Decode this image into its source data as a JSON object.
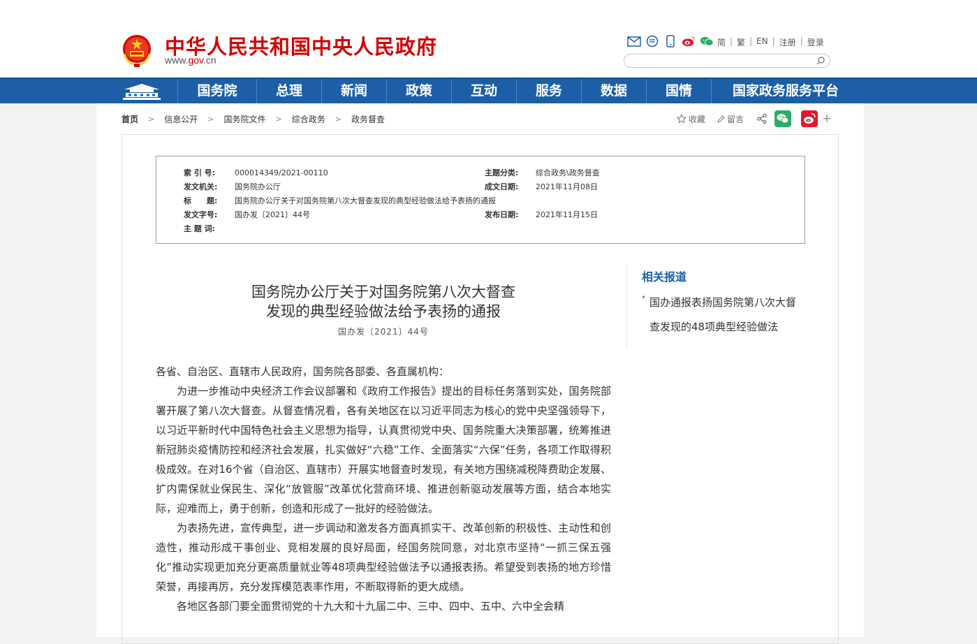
{
  "header": {
    "site_title": "中华人民共和国中央人民政府",
    "site_url_prefix": "www.",
    "site_url_brand": "gov",
    "site_url_suffix": ".cn",
    "links": [
      "简",
      "繁",
      "EN",
      "注册",
      "登录"
    ],
    "icons": [
      "mail-icon",
      "message-icon",
      "mobile-icon",
      "weibo-icon",
      "wechat-icon"
    ],
    "search_placeholder": ""
  },
  "nav": {
    "items": [
      "国务院",
      "总理",
      "新闻",
      "政策",
      "互动",
      "服务",
      "数据",
      "国情",
      "国家政务服务平台"
    ]
  },
  "breadcrumb": [
    "首页",
    "信息公开",
    "国务院文件",
    "综合政务",
    "政务督查"
  ],
  "tools": {
    "favorite": "收藏",
    "comment": "留言",
    "plus": "+"
  },
  "meta": {
    "index_label": "索 引 号:",
    "index_value": "000014349/2021-00110",
    "topic_label": "主题分类:",
    "topic_value": "综合政务\\政务督查",
    "issuer_label": "发文机关:",
    "issuer_value": "国务院办公厅",
    "created_label": "成文日期:",
    "created_value": "2021年11月08日",
    "title_label": "标　　题:",
    "title_value": "国务院办公厅关于对国务院第八次大督查发现的典型经验做法给予表扬的通报",
    "docno_label": "发文字号:",
    "docno_value": "国办发〔2021〕44号",
    "published_label": "发布日期:",
    "published_value": "2021年11月15日",
    "keywords_label": "主 题 词:",
    "keywords_value": ""
  },
  "article": {
    "title_line1": "国务院办公厅关于对国务院第八次大督查",
    "title_line2": "发现的典型经验做法给予表扬的通报",
    "doc_no": "国办发〔2021〕44号",
    "salutation": "各省、自治区、直辖市人民政府，国务院各部委、各直属机构：",
    "p1": "为进一步推动中央经济工作会议部署和《政府工作报告》提出的目标任务落到实处，国务院部署开展了第八次大督查。从督查情况看，各有关地区在以习近平同志为核心的党中央坚强领导下，以习近平新时代中国特色社会主义思想为指导，认真贯彻党中央、国务院重大决策部署，统筹推进新冠肺炎疫情防控和经济社会发展，扎实做好“六稳”工作、全面落实“六保”任务，各项工作取得积极成效。在对16个省（自治区、直辖市）开展实地督查时发现，有关地方围绕减税降费助企发展、扩内需保就业保民生、深化“放管服”改革优化营商环境、推进创新驱动发展等方面，结合本地实际，迎难而上，勇于创新，创造和形成了一批好的经验做法。",
    "p2": "为表扬先进，宣传典型，进一步调动和激发各方面真抓实干、改革创新的积极性、主动性和创造性，推动形成干事创业、竞相发展的良好局面，经国务院同意，对北京市坚持“一抓三保五强化”推动实现更加充分更高质量就业等48项典型经验做法予以通报表扬。希望受到表扬的地方珍惜荣誉，再接再厉，充分发挥模范表率作用，不断取得新的更大成绩。",
    "p3": "各地区各部门要全面贯彻党的十九大和十九届二中、三中、四中、五中、六中全会精"
  },
  "sidebar": {
    "title": "相关报道",
    "item": "国办通报表扬国务院第八次大督查发现的48项典型经验做法"
  },
  "colors": {
    "brand_red": "#d40000",
    "nav_blue": "#1c5fa6",
    "wechat_green": "#2aae67",
    "weibo_red": "#e6162d"
  }
}
